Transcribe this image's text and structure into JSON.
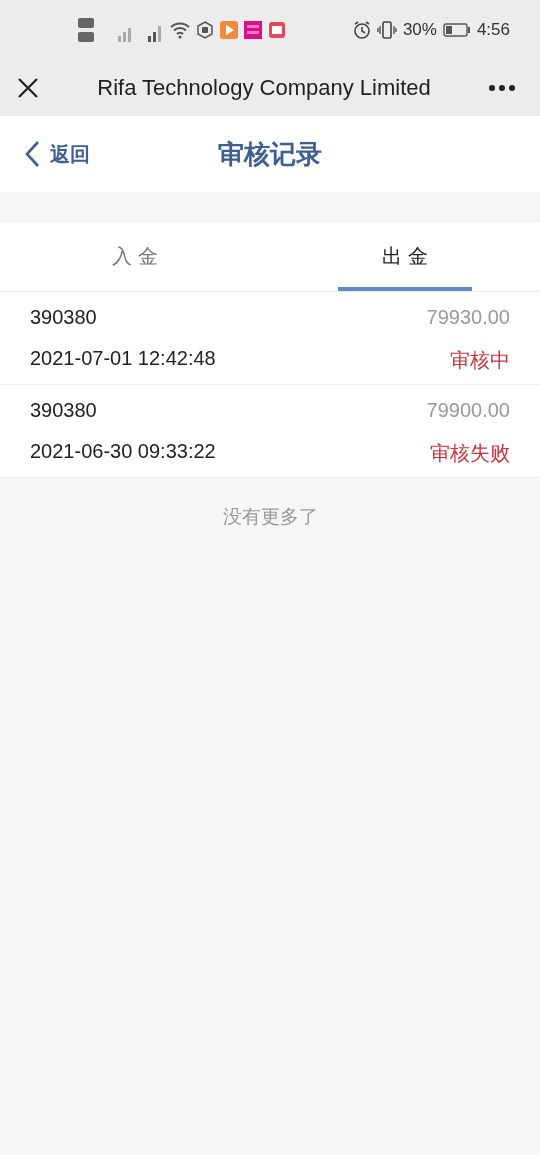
{
  "status_bar": {
    "battery_text": "30%",
    "time": "4:56"
  },
  "browser_bar": {
    "title": "Rifa Technology Company Limited"
  },
  "header": {
    "back": "返回",
    "title": "审核记录"
  },
  "tabs": [
    {
      "label": "入 金",
      "selected": false
    },
    {
      "label": "出 金",
      "selected": true
    }
  ],
  "records": [
    {
      "account": "390380",
      "amount": "79930.00",
      "time": "2021-07-01 12:42:48",
      "status": "审核中"
    },
    {
      "account": "390380",
      "amount": "79900.00",
      "time": "2021-06-30 09:33:22",
      "status": "审核失败"
    }
  ],
  "footer_note": "没有更多了"
}
